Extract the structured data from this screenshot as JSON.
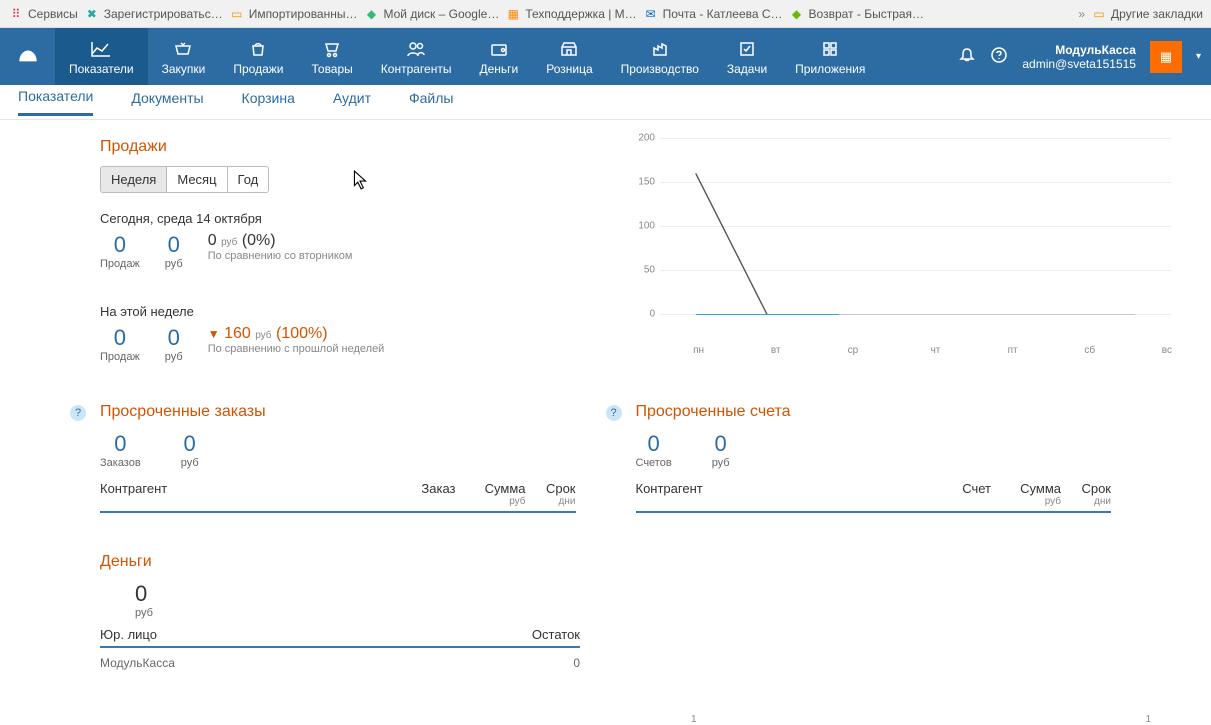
{
  "bookmarks": [
    {
      "icon": "⠿",
      "color": "#d34",
      "label": "Сервисы"
    },
    {
      "icon": "✖",
      "color": "#2aa",
      "label": "Зарегистрироватьс…"
    },
    {
      "icon": "▭",
      "color": "#e90",
      "label": "Импортированны…"
    },
    {
      "icon": "◆",
      "color": "#3b7",
      "label": "Мой диск – Google…"
    },
    {
      "icon": "▦",
      "color": "#f80",
      "label": "Техподдержка | М…"
    },
    {
      "icon": "✉",
      "color": "#06c",
      "label": "Почта - Катлеева С…"
    },
    {
      "icon": "◆",
      "color": "#6b0",
      "label": "Возврат - Быстрая…"
    }
  ],
  "other_bookmarks": "Другие закладки",
  "nav": [
    {
      "label": "Показатели"
    },
    {
      "label": "Закупки"
    },
    {
      "label": "Продажи"
    },
    {
      "label": "Товары"
    },
    {
      "label": "Контрагенты"
    },
    {
      "label": "Деньги"
    },
    {
      "label": "Розница"
    },
    {
      "label": "Производство"
    },
    {
      "label": "Задачи"
    },
    {
      "label": "Приложения"
    }
  ],
  "user": {
    "name": "МодульКасса",
    "login": "admin@sveta151515"
  },
  "subnav": [
    {
      "label": "Показатели"
    },
    {
      "label": "Документы"
    },
    {
      "label": "Корзина"
    },
    {
      "label": "Аудит"
    },
    {
      "label": "Файлы"
    }
  ],
  "sales": {
    "title": "Продажи",
    "tabs": [
      "Неделя",
      "Месяц",
      "Год"
    ],
    "today": {
      "label": "Сегодня, среда 14 октября",
      "sales_count": "0",
      "sales_label": "Продаж",
      "rub_count": "0",
      "rub_label": "руб",
      "cmp_value": "0",
      "cmp_currency": "руб",
      "cmp_pct": "(0%)",
      "cmp_sub": "По сравнению со вторником"
    },
    "week": {
      "label": "На этой неделе",
      "sales_count": "0",
      "sales_label": "Продаж",
      "rub_count": "0",
      "rub_label": "руб",
      "cmp_arrow": "▼",
      "cmp_value": "160",
      "cmp_currency": "руб",
      "cmp_pct": "(100%)",
      "cmp_sub": "По сравнению с прошлой неделей"
    }
  },
  "chart_data": {
    "type": "line",
    "x": [
      "пн",
      "вт",
      "ср",
      "чт",
      "пт",
      "сб",
      "вс"
    ],
    "values": [
      160,
      0,
      0,
      0,
      0,
      0,
      0
    ],
    "ylim": [
      0,
      200
    ],
    "yticks": [
      0,
      50,
      100,
      150,
      200
    ],
    "xlabel": "",
    "ylabel": ""
  },
  "overdue_orders": {
    "title": "Просроченные заказы",
    "orders_count": "0",
    "orders_label": "Заказов",
    "rub_count": "0",
    "rub_label": "руб",
    "headers": {
      "c1": "Контрагент",
      "c2": "Заказ",
      "c3": "Сумма",
      "c3_sub": "руб",
      "c4": "Срок",
      "c4_sub": "дни"
    }
  },
  "overdue_invoices": {
    "title": "Просроченные счета",
    "invoices_count": "0",
    "invoices_label": "Счетов",
    "rub_count": "0",
    "rub_label": "руб",
    "headers": {
      "c1": "Контрагент",
      "c2": "Счет",
      "c3": "Сумма",
      "c3_sub": "руб",
      "c4": "Срок",
      "c4_sub": "дни"
    }
  },
  "money": {
    "title": "Деньги",
    "amount": "0",
    "amount_label": "руб",
    "headers": {
      "c1": "Юр. лицо",
      "c2": "Остаток"
    },
    "row1_name": "МодульКасса",
    "row1_val": "0",
    "chart_right": {
      "left": "1",
      "right": "1"
    }
  }
}
